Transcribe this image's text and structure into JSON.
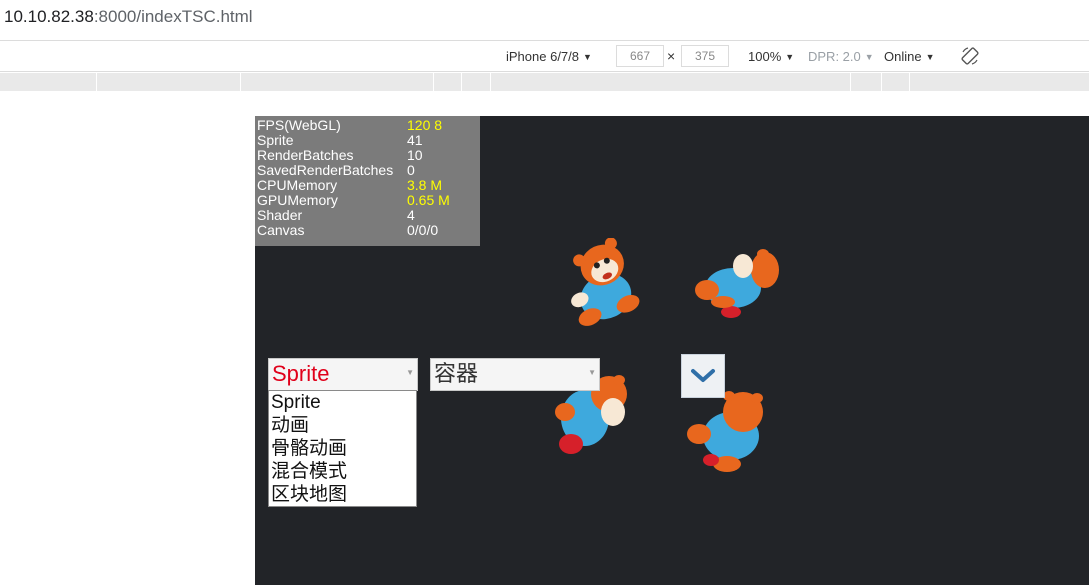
{
  "address_bar": {
    "host": "10.10.82.38",
    "path": ":8000/indexTSC.html"
  },
  "device_toolbar": {
    "device": "iPhone 6/7/8",
    "width": "667",
    "times": "×",
    "height": "375",
    "zoom": "100%",
    "dpr": "DPR: 2.0",
    "network": "Online",
    "rotate_icon": "rotate-icon"
  },
  "stats": {
    "rows": [
      {
        "label": "FPS(WebGL)",
        "value": "120 8",
        "highlight": true
      },
      {
        "label": "Sprite",
        "value": "41",
        "highlight": false
      },
      {
        "label": "RenderBatches",
        "value": "10",
        "highlight": false
      },
      {
        "label": "SavedRenderBatches",
        "value": "0",
        "highlight": false
      },
      {
        "label": "CPUMemory",
        "value": "3.8 M",
        "highlight": true
      },
      {
        "label": "GPUMemory",
        "value": "0.65 M",
        "highlight": true
      },
      {
        "label": "Shader",
        "value": "4",
        "highlight": false
      },
      {
        "label": "Canvas",
        "value": "0/0/0",
        "highlight": false
      }
    ]
  },
  "category_select": {
    "value": "Sprite",
    "options": [
      "Sprite",
      "动画",
      "骨骼动画",
      "混合模式",
      "区块地图"
    ]
  },
  "sub_select": {
    "value": "容器"
  },
  "dropdown_button_icon": "chevron-down-icon",
  "colors": {
    "stage": "#222428",
    "stats_bg": "#7b7b7b",
    "highlight": "#ffff00",
    "selected": "#e0001a"
  }
}
